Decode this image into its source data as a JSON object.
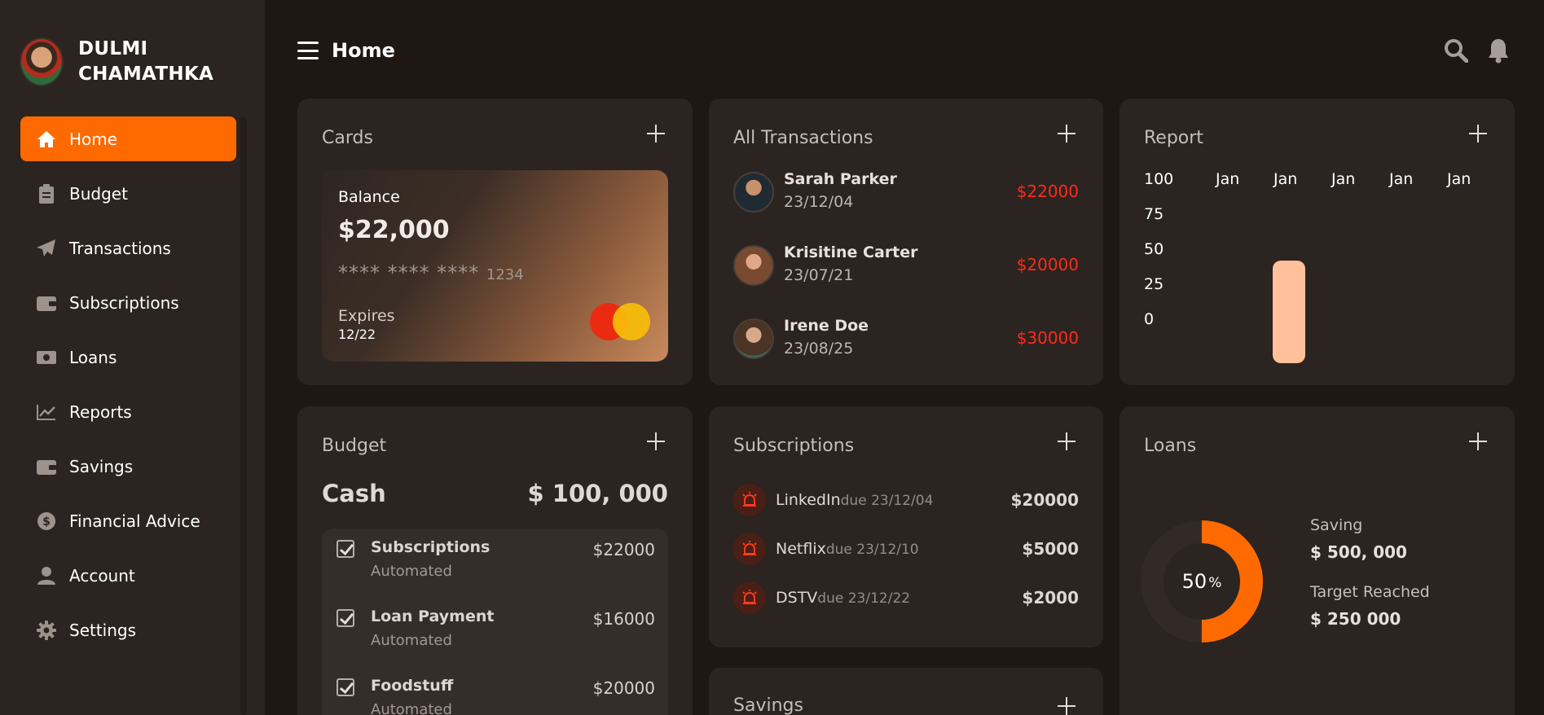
{
  "profile": {
    "name": "DULMI CHAMATHKA"
  },
  "nav": {
    "items": [
      {
        "label": "Home",
        "icon": "home-icon"
      },
      {
        "label": "Budget",
        "icon": "clipboard-icon"
      },
      {
        "label": "Transactions",
        "icon": "paper-plane-icon"
      },
      {
        "label": "Subscriptions",
        "icon": "wallet-icon"
      },
      {
        "label": "Loans",
        "icon": "money-icon"
      },
      {
        "label": "Reports",
        "icon": "chart-line-icon"
      },
      {
        "label": "Savings",
        "icon": "wallet-icon"
      },
      {
        "label": "Financial Advice",
        "icon": "dollar-circle-icon"
      },
      {
        "label": "Account",
        "icon": "user-icon"
      },
      {
        "label": "Settings",
        "icon": "gear-icon"
      }
    ]
  },
  "header": {
    "title": "Home"
  },
  "cards": {
    "title": "Cards",
    "balance_label": "Balance",
    "balance": "$22,000",
    "number_mask": "**** **** ****",
    "number_last": "1234",
    "expires_label": "Expires",
    "expires": "12/22"
  },
  "transactions": {
    "title": "All Transactions",
    "items": [
      {
        "name": "Sarah Parker",
        "date": "23/12/04",
        "amount": "$22000"
      },
      {
        "name": "Krisitine Carter",
        "date": "23/07/21",
        "amount": "$20000"
      },
      {
        "name": "Irene Doe",
        "date": "23/08/25",
        "amount": "$30000"
      }
    ]
  },
  "report": {
    "title": "Report",
    "chart_data": {
      "type": "bar",
      "categories": [
        "Jan",
        "Jan",
        "Jan",
        "Jan",
        "Jan"
      ],
      "values": [
        0,
        55,
        0,
        0,
        0
      ],
      "ylim": [
        0,
        100
      ],
      "yticks": [
        "100",
        "75",
        "50",
        "25",
        "0"
      ],
      "grid": false,
      "bar_color": "#ffc09a"
    }
  },
  "budget": {
    "title": "Budget",
    "cash_label": "Cash",
    "cash_value": "$ 100, 000",
    "items": [
      {
        "name": "Subscriptions",
        "sub": "Automated",
        "amount": "$22000"
      },
      {
        "name": "Loan Payment",
        "sub": "Automated",
        "amount": "$16000"
      },
      {
        "name": "Foodstuff",
        "sub": "Automated",
        "amount": "$20000"
      }
    ]
  },
  "subscriptions": {
    "title": "Subscriptions",
    "items": [
      {
        "name": "LinkedIn",
        "due": "due 23/12/04",
        "amount": "$20000"
      },
      {
        "name": "Netflix",
        "due": "due 23/12/10",
        "amount": "$5000"
      },
      {
        "name": "DSTV",
        "due": "due 23/12/22",
        "amount": "$2000"
      }
    ]
  },
  "savings": {
    "title": "Savings"
  },
  "loans": {
    "title": "Loans",
    "progress_value": "50",
    "progress_unit": "%",
    "progress_fraction": 0.5,
    "saving_label": "Saving",
    "saving_value": "$ 500, 000",
    "target_label": "Target Reached",
    "target_value": "$ 250 000"
  },
  "colors": {
    "accent": "#ff6a00",
    "negative": "#ff2b1a",
    "background": "#1f1714",
    "panel": "#2b2421"
  }
}
